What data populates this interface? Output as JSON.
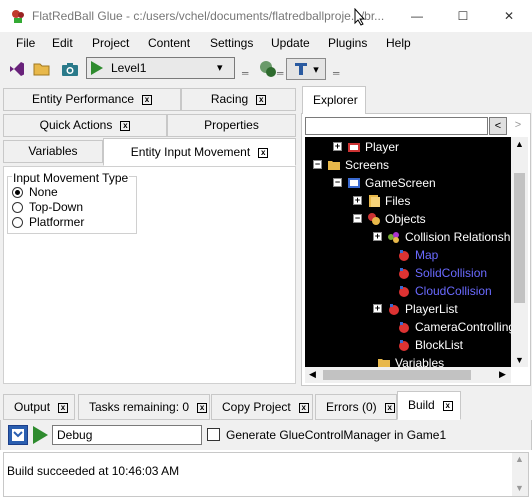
{
  "window": {
    "title": "FlatRedBall Glue - c:/users/vchel/documents/flatredballproje.../br...",
    "minimize_glyph": "—",
    "maximize_glyph": "☐",
    "close_glyph": "✕"
  },
  "menu": [
    "File",
    "Edit",
    "Project",
    "Content",
    "Settings",
    "Update",
    "Plugins",
    "Help"
  ],
  "toolbar": {
    "level_combo_value": "Level1",
    "icons": [
      "visual-studio-icon",
      "open-folder-icon",
      "camera-icon",
      "play-icon",
      "glue-connect-icon",
      "text-tool-icon"
    ],
    "dropdown_glyph": "▾"
  },
  "left_tabs": {
    "row1": [
      {
        "label": "Entity Performance",
        "close": "x"
      },
      {
        "label": "Racing",
        "close": "x"
      }
    ],
    "row2": [
      {
        "label": "Quick Actions",
        "close": "x"
      },
      {
        "label": "Properties"
      }
    ],
    "row3": [
      {
        "label": "Variables"
      },
      {
        "label": "Entity Input Movement",
        "close": "x"
      }
    ]
  },
  "input_movement": {
    "group_title": "Input Movement Type",
    "options": [
      {
        "label": "None",
        "checked": true
      },
      {
        "label": "Top-Down",
        "checked": false
      },
      {
        "label": "Platformer",
        "checked": false
      }
    ]
  },
  "explorer": {
    "tab_label": "Explorer",
    "search_value": "",
    "back_glyph": "<",
    "forward_glyph": ">",
    "tree": [
      {
        "label": "Player",
        "expander": "+",
        "icon": "entity-icon",
        "color": "#ffffff"
      },
      {
        "label": "Screens",
        "expander": "−",
        "icon": "folder-icon",
        "color": "#ffffff"
      },
      {
        "label": "GameScreen",
        "expander": "−",
        "icon": "screen-icon",
        "color": "#ffffff"
      },
      {
        "label": "Files",
        "expander": "+",
        "icon": "files-icon",
        "color": "#ffffff"
      },
      {
        "label": "Objects",
        "expander": "−",
        "icon": "objects-icon",
        "color": "#ffffff"
      },
      {
        "label": "Collision Relationsh",
        "expander": "+",
        "icon": "collision-icon",
        "color": "#ffffff"
      },
      {
        "label": "Map",
        "expander": "",
        "icon": "object-icon",
        "color": "#6a6aff"
      },
      {
        "label": "SolidCollision",
        "expander": "",
        "icon": "object-icon",
        "color": "#6a6aff"
      },
      {
        "label": "CloudCollision",
        "expander": "",
        "icon": "object-icon",
        "color": "#6a6aff"
      },
      {
        "label": "PlayerList",
        "expander": "+",
        "icon": "object-icon",
        "color": "#ffffff"
      },
      {
        "label": "CameraControlling",
        "expander": "",
        "icon": "object-icon",
        "color": "#ffffff"
      },
      {
        "label": "BlockList",
        "expander": "",
        "icon": "object-icon",
        "color": "#ffffff"
      },
      {
        "label": "Variables",
        "expander": "",
        "icon": "folder-icon",
        "color": "#ffffff"
      }
    ]
  },
  "bottom_tabs": [
    {
      "label": "Output",
      "close": "x"
    },
    {
      "label": "Tasks remaining: 0",
      "close": "x"
    },
    {
      "label": "Copy Project",
      "close": "x"
    },
    {
      "label": "Errors (0)",
      "close": "x"
    },
    {
      "label": "Build",
      "close": "x"
    }
  ],
  "build": {
    "configuration": "Debug",
    "generate_label": "Generate GlueControlManager in Game1",
    "generate_checked": false,
    "output": "Build succeeded at 10:46:03 AM"
  },
  "colors": {
    "tree_bg": "#000000",
    "tree_text": "#ffffff",
    "tree_link": "#6a6aff",
    "chrome_bg": "#f0f0f0"
  }
}
